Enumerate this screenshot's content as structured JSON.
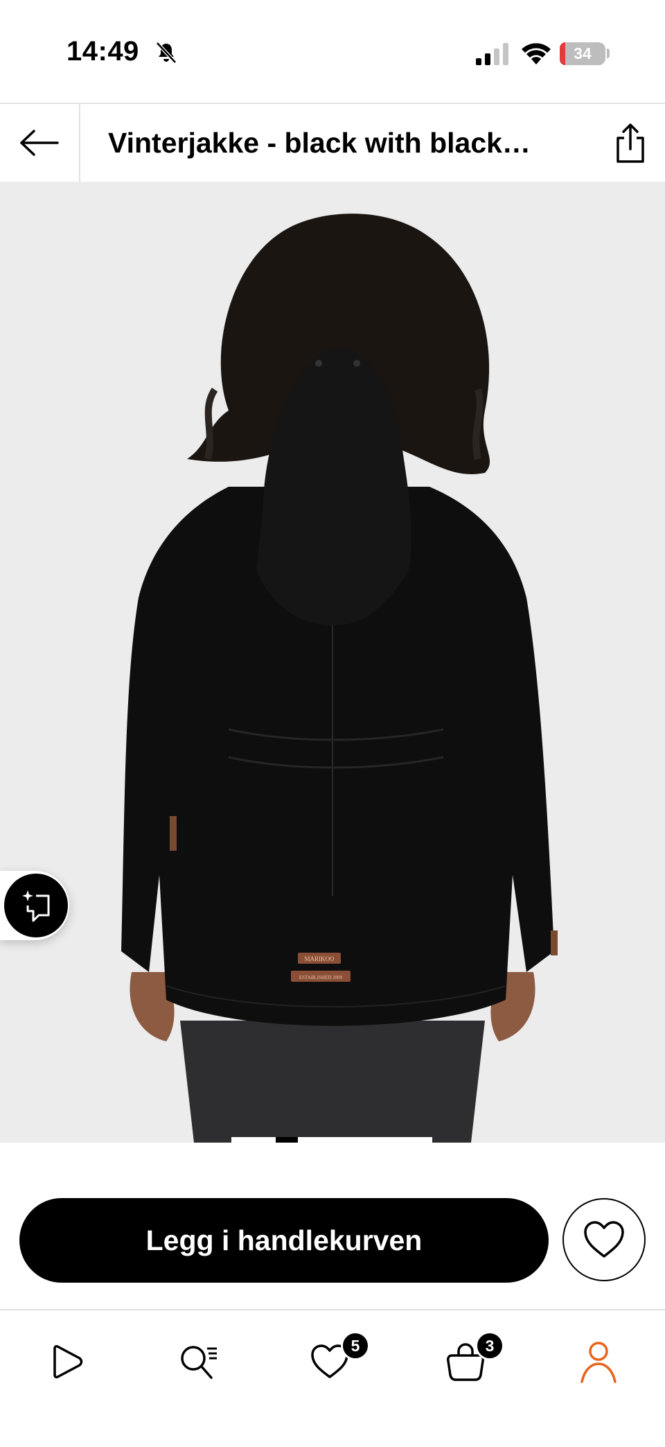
{
  "status_bar": {
    "time": "14:49",
    "battery": "34"
  },
  "nav": {
    "title": "Vinterjakke - black with black…",
    "back_icon": "arrow-left-icon",
    "share_icon": "share-icon"
  },
  "product": {
    "image_description": "",
    "label_patches": [
      "MARIKOO",
      "ESTABLISHED 2009"
    ]
  },
  "cta": {
    "add_to_cart_label": "Legg i handlekurven",
    "wishlist_icon": "heart-outline-icon"
  },
  "tabs": [
    {
      "name": "home",
      "icon": "play-triangle-icon"
    },
    {
      "name": "search",
      "icon": "search-list-icon"
    },
    {
      "name": "wishlist",
      "icon": "heart-icon",
      "badge": "5"
    },
    {
      "name": "cart",
      "icon": "shopping-bag-icon",
      "badge": "3"
    },
    {
      "name": "profile",
      "icon": "person-icon",
      "active_color": "#e8641b"
    }
  ],
  "colors": {
    "accent": "#e8641b",
    "primary": "#000000",
    "image_bg": "#ececec"
  }
}
